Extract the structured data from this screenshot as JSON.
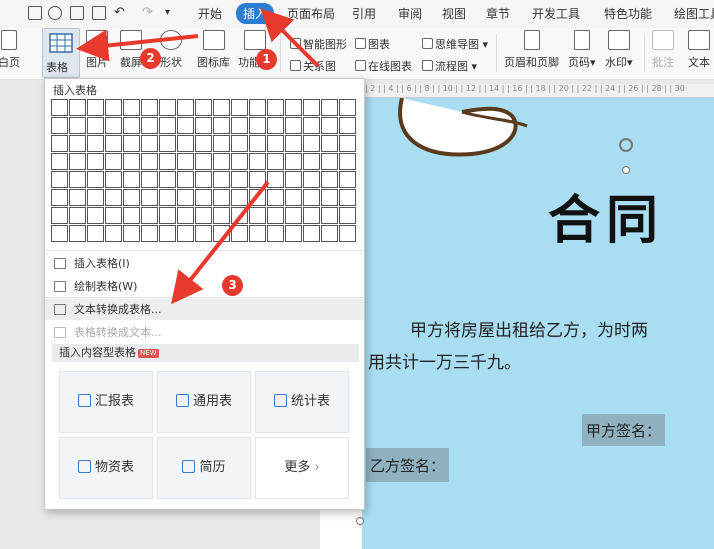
{
  "menubar": {
    "items": [
      "开始",
      "插入",
      "页面布局",
      "引用",
      "审阅",
      "视图",
      "章节",
      "开发工具",
      "特色功能",
      "绘图工具"
    ],
    "active": "插入"
  },
  "ribbon": {
    "blank_page": "白页",
    "table": "表格",
    "picture": "图片",
    "screenshot": "截屏",
    "shape": "形状",
    "icon_lib": "图标库",
    "function_map": "功能图",
    "smart_shape": "智能图形",
    "chart": "图表",
    "mind_map": "思维导图",
    "relation_map": "关系图",
    "online_chart": "在线图表",
    "flow_chart": "流程图",
    "header_footer": "页眉和页脚",
    "page_num": "页码",
    "watermark": "水印",
    "comment": "批注",
    "textbox": "文本"
  },
  "dropdown": {
    "header": "插入表格",
    "grid_rows": 8,
    "grid_cols": 17,
    "items": {
      "insert_table": "插入表格(I)",
      "draw_table": "绘制表格(W)",
      "text_to_table": "文本转换成表格...",
      "table_to_text": "表格转换成文本..."
    },
    "section_title": "插入内容型表格",
    "badge": "NEW",
    "templates": [
      "汇报表",
      "通用表",
      "统计表",
      "物资表",
      "简历",
      "更多"
    ]
  },
  "document": {
    "title": "合同",
    "para1": "甲方将房屋出租给乙方，为时两",
    "para2": "用共计一万三千九。",
    "sig_a": "甲方签名：",
    "sig_b": "乙方签名："
  },
  "annotations": [
    "1",
    "2",
    "3"
  ],
  "colors": {
    "accent": "#2b7cd3",
    "page_bg": "#a8ddf2",
    "highlight": "#8fb1c0",
    "arrow": "#e8392d"
  }
}
